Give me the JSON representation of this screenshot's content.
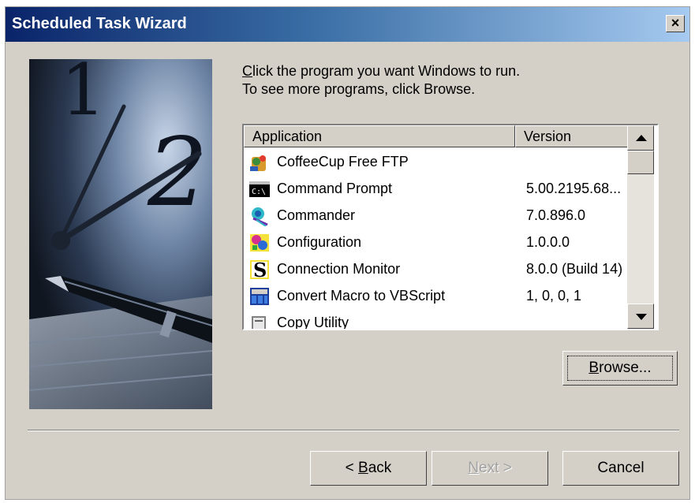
{
  "window": {
    "title": "Scheduled Task Wizard",
    "close_glyph": "×"
  },
  "instructions": {
    "line1_underlined": "C",
    "line1_rest": "lick the program you want Windows to run.",
    "line2": "To see more programs, click Browse."
  },
  "listview": {
    "columns": [
      "Application",
      "Version"
    ],
    "rows": [
      {
        "name": "CoffeeCup Free FTP",
        "version": "",
        "icon": "coffeecup-icon"
      },
      {
        "name": "Command Prompt",
        "version": "5.00.2195.68...",
        "icon": "command-prompt-icon"
      },
      {
        "name": "Commander",
        "version": "7.0.896.0",
        "icon": "commander-icon"
      },
      {
        "name": "Configuration",
        "version": "1.0.0.0",
        "icon": "configuration-icon"
      },
      {
        "name": "Connection Monitor",
        "version": "8.0.0 (Build 14)",
        "icon": "connection-monitor-icon"
      },
      {
        "name": "Convert Macro to VBScript",
        "version": "1, 0, 0, 1",
        "icon": "vbscript-icon"
      },
      {
        "name": "Copy Utility",
        "version": "",
        "icon": "copy-utility-icon"
      }
    ]
  },
  "buttons": {
    "browse_ul": "B",
    "browse_rest": "rowse...",
    "back_prefix": "< ",
    "back_ul": "B",
    "back_rest": "ack",
    "next_ul": "N",
    "next_rest": "ext >",
    "cancel": "Cancel"
  }
}
